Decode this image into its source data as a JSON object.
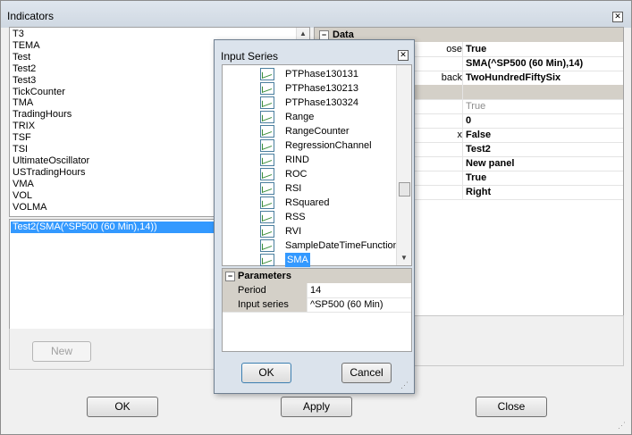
{
  "window": {
    "title": "Indicators"
  },
  "indicator_list": [
    "T3",
    "TEMA",
    "Test",
    "Test2",
    "Test3",
    "TickCounter",
    "TMA",
    "TradingHours",
    "TRIX",
    "TSF",
    "TSI",
    "UltimateOscillator",
    "USTradingHours",
    "VMA",
    "VOL",
    "VOLMA"
  ],
  "applied_list": [
    "Test2(SMA(^SP500 (60 Min),14))"
  ],
  "buttons": {
    "new": "New",
    "ok": "OK",
    "apply": "Apply",
    "close": "Close"
  },
  "properties": {
    "section": "Data",
    "rows": [
      {
        "label_partial": "ose",
        "value": "True"
      },
      {
        "label_partial": "",
        "value": "SMA(^SP500 (60 Min),14)"
      },
      {
        "label_partial": "back",
        "value": "TwoHundredFiftySix"
      },
      {
        "label_partial": "",
        "value": ""
      },
      {
        "label_partial": "",
        "value": "True"
      },
      {
        "label_partial": "",
        "value": "0"
      },
      {
        "label_partial": "x",
        "value": "False"
      },
      {
        "label_partial": "",
        "value": "Test2"
      },
      {
        "label_partial": "",
        "value": "New panel"
      },
      {
        "label_partial": "",
        "value": "True"
      },
      {
        "label_partial": "",
        "value": "Right"
      }
    ]
  },
  "dialog": {
    "title": "Input Series",
    "items": [
      "PTPhase130131",
      "PTPhase130213",
      "PTPhase130324",
      "Range",
      "RangeCounter",
      "RegressionChannel",
      "RIND",
      "ROC",
      "RSI",
      "RSquared",
      "RSS",
      "RVI",
      "SampleDateTimeFunctions",
      "SMA"
    ],
    "selected": "SMA",
    "params_header": "Parameters",
    "params": [
      {
        "label": "Period",
        "value": "14"
      },
      {
        "label": "Input series",
        "value": "^SP500 (60 Min)"
      }
    ],
    "ok": "OK",
    "cancel": "Cancel"
  }
}
